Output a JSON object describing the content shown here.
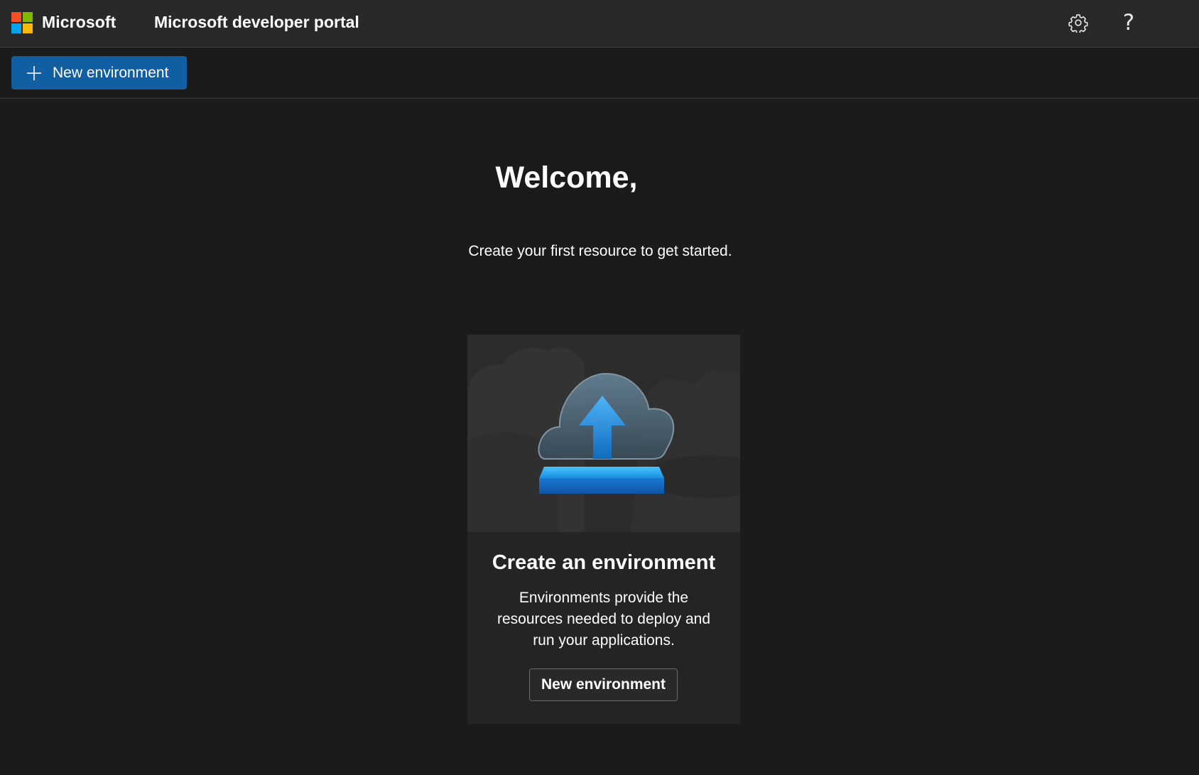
{
  "header": {
    "brand": "Microsoft",
    "title": "Microsoft developer portal",
    "settings_icon": "gear-icon",
    "help_icon": "help-icon",
    "help_glyph": "?"
  },
  "logo_colors": [
    "#f25022",
    "#7fba00",
    "#00a4ef",
    "#ffb900"
  ],
  "commandbar": {
    "new_environment_label": "New environment",
    "accent_color": "#115ea3"
  },
  "main": {
    "welcome": "Welcome,",
    "subtitle": "Create your first resource to get started."
  },
  "card": {
    "illustration": "cloud-upload-icon",
    "title": "Create an environment",
    "description": "Environments provide the resources needed to deploy and run your applications.",
    "button_label": "New environment"
  }
}
